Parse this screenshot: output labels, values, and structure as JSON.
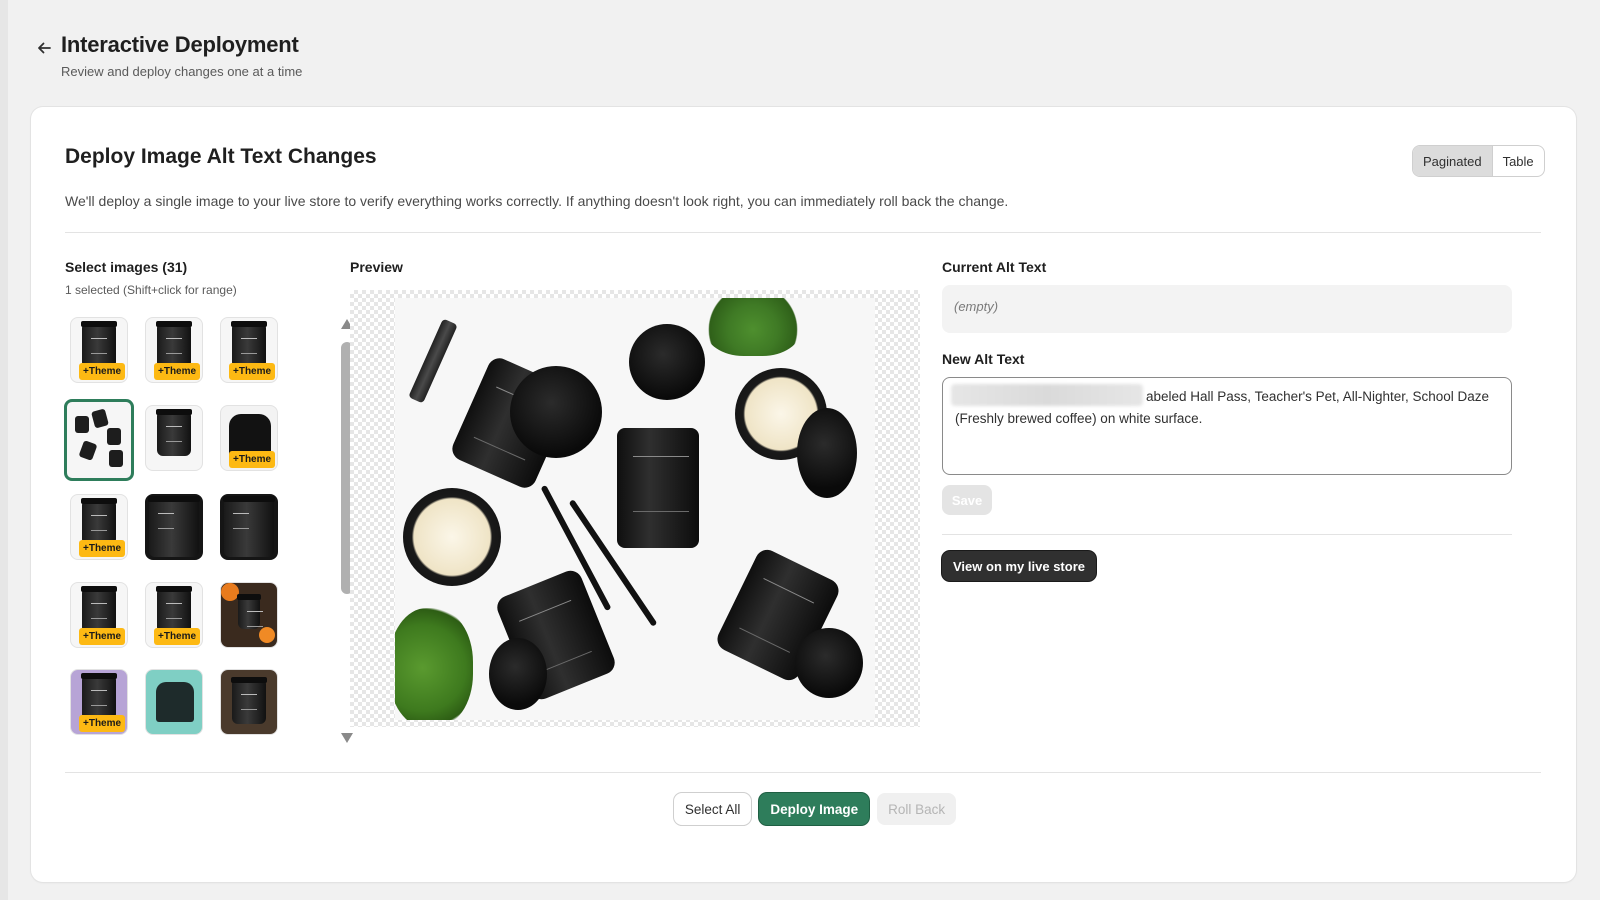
{
  "header": {
    "title": "Interactive Deployment",
    "subtitle": "Review and deploy changes one at a time"
  },
  "card": {
    "title": "Deploy Image Alt Text Changes",
    "description": "We'll deploy a single image to your live store to verify everything works correctly. If anything doesn't look right, you can immediately roll back the change.",
    "view_toggle": {
      "options": [
        "Paginated",
        "Table"
      ],
      "selected": "Paginated"
    }
  },
  "selector": {
    "title": "Select images (31)",
    "subtitle": "1 selected (Shift+click for range)",
    "badge_label": "+Theme",
    "thumbnails": [
      {
        "style": "black-jar",
        "badge": true
      },
      {
        "style": "black-jar",
        "badge": true
      },
      {
        "style": "black-jar",
        "badge": true
      },
      {
        "style": "multi-jar",
        "badge": false,
        "selected": true
      },
      {
        "style": "black-jar",
        "badge": false
      },
      {
        "style": "sweatshirt",
        "badge": true
      },
      {
        "style": "black-jar",
        "badge": true
      },
      {
        "style": "dark-jar",
        "badge": false
      },
      {
        "style": "dark-jar",
        "badge": false
      },
      {
        "style": "black-jar",
        "badge": true
      },
      {
        "style": "black-jar",
        "badge": true
      },
      {
        "style": "orange-still-life",
        "badge": false
      },
      {
        "style": "purple-floral",
        "badge": true
      },
      {
        "style": "teal-shirt",
        "badge": false
      },
      {
        "style": "brown-jar",
        "badge": false
      }
    ]
  },
  "preview": {
    "title": "Preview"
  },
  "alt_text": {
    "current_label": "Current Alt Text",
    "current_value": "(empty)",
    "new_label": "New Alt Text",
    "new_value_line1": "abeled Hall Pass, Teacher's Pet, All-Nighter, School Daze",
    "new_value_line2": "(Freshly brewed coffee) on white surface.",
    "save_label": "Save",
    "live_store_label": "View on my live store"
  },
  "footer": {
    "select_all_label": "Select All",
    "deploy_label": "Deploy Image",
    "rollback_label": "Roll Back"
  },
  "colors": {
    "primary": "#2e7d5b",
    "badge": "#fdb913",
    "dark_button": "#303030"
  }
}
